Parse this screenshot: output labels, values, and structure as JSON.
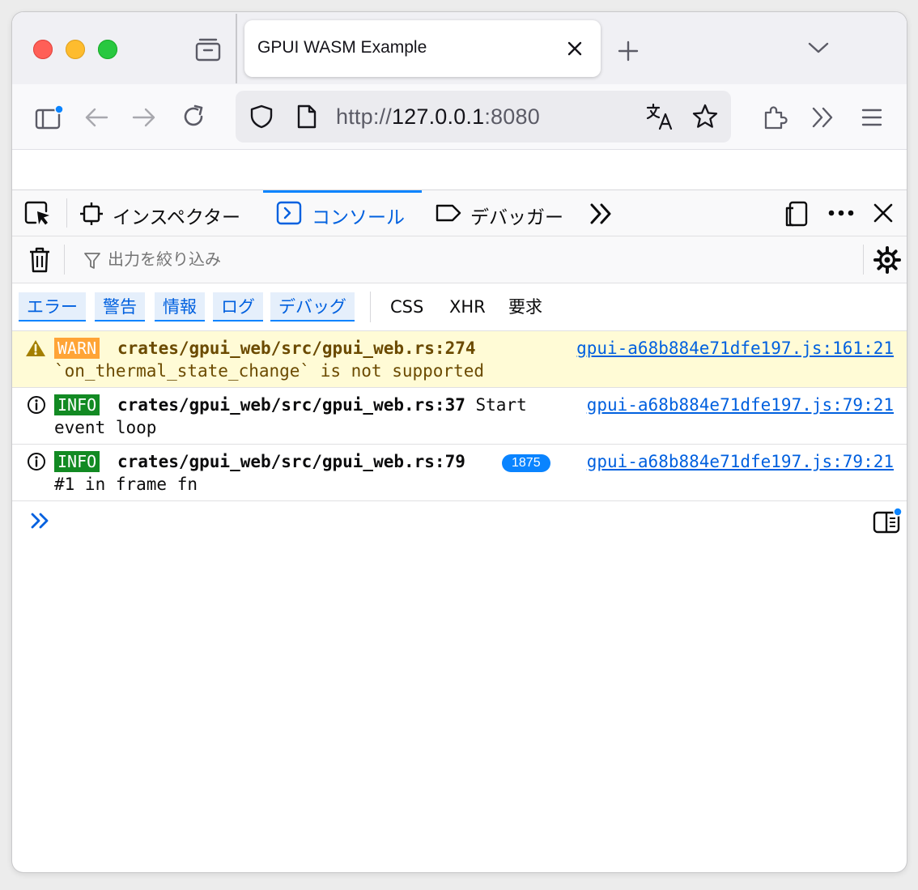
{
  "window": {
    "tab_title": "GPUI WASM Example"
  },
  "navbar": {
    "url_scheme": "http://",
    "url_host": "127.0.0.1",
    "url_port": ":8080"
  },
  "devtools": {
    "tabs": [
      {
        "label": "インスペクター",
        "active": false
      },
      {
        "label": "コンソール",
        "active": true
      },
      {
        "label": "デバッガー",
        "active": false
      }
    ],
    "filter_placeholder": "出力を絞り込み",
    "levels": [
      "エラー",
      "警告",
      "情報",
      "ログ",
      "デバッグ"
    ],
    "extra_filters": [
      "CSS",
      "XHR",
      "要求"
    ]
  },
  "console": {
    "messages": [
      {
        "level": "WARN",
        "source_path": "crates/gpui_web/src/gpui_web.rs:274",
        "text_inline": "",
        "text_line2": "`on_thermal_state_change` is not supported",
        "location": "gpui-a68b884e71dfe197.js:161:21"
      },
      {
        "level": "INFO",
        "source_path": "crates/gpui_web/src/gpui_web.rs:37",
        "text_inline": " Start",
        "text_line2": "event loop",
        "location": "gpui-a68b884e71dfe197.js:79:21"
      },
      {
        "level": "INFO",
        "source_path": "crates/gpui_web/src/gpui_web.rs:79",
        "text_inline": "",
        "text_line2": "#1 in frame fn",
        "repeat_count": "1875",
        "location": "gpui-a68b884e71dfe197.js:79:21"
      }
    ]
  },
  "colors": {
    "accent": "#0a84ff",
    "warn_badge": "#ffa436",
    "info_badge": "#128a23",
    "warn_bg": "#fffbd6"
  }
}
